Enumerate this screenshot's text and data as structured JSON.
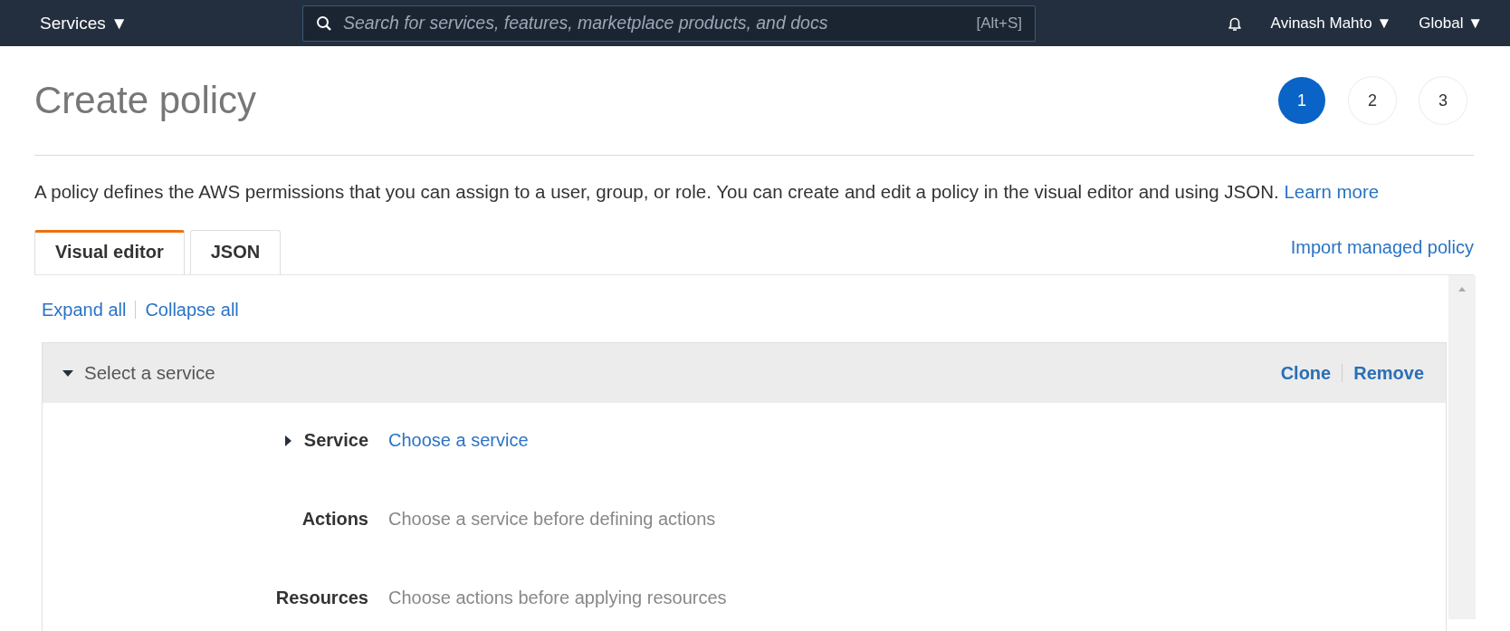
{
  "top_bar": {
    "services_menu": "Services ▼",
    "search": {
      "placeholder": "Search for services, features, marketplace products, and docs",
      "shortcut": "[Alt+S]"
    },
    "user_menu": "Avinash Mahto ▼",
    "region_menu": "Global ▼"
  },
  "title": "Create policy",
  "steps": [
    {
      "label": "1",
      "selected": true
    },
    {
      "label": "2",
      "selected": false
    },
    {
      "label": "3",
      "selected": false
    }
  ],
  "description": {
    "text": "A policy defines the AWS permissions that you can assign to a user, group, or role. You can create and edit a policy in the visual editor and using JSON.",
    "link": "Learn more"
  },
  "tabs": [
    {
      "label": "Visual editor",
      "selected": true
    },
    {
      "label": "JSON",
      "selected": false
    }
  ],
  "import_link": "Import managed policy",
  "toggle_links": [
    "Expand all",
    "Collapse all"
  ],
  "statement": {
    "title": "Select a service",
    "expanded": true,
    "actions": [
      "Clone",
      "Remove"
    ],
    "rows": [
      {
        "label": "Service",
        "kind": "link",
        "value": "Choose a service",
        "expandable": true
      },
      {
        "label": "Actions",
        "kind": "hint",
        "value": "Choose a service before defining actions",
        "expandable": false
      },
      {
        "label": "Resources",
        "kind": "hint",
        "value": "Choose actions before applying resources",
        "expandable": false
      }
    ]
  }
}
